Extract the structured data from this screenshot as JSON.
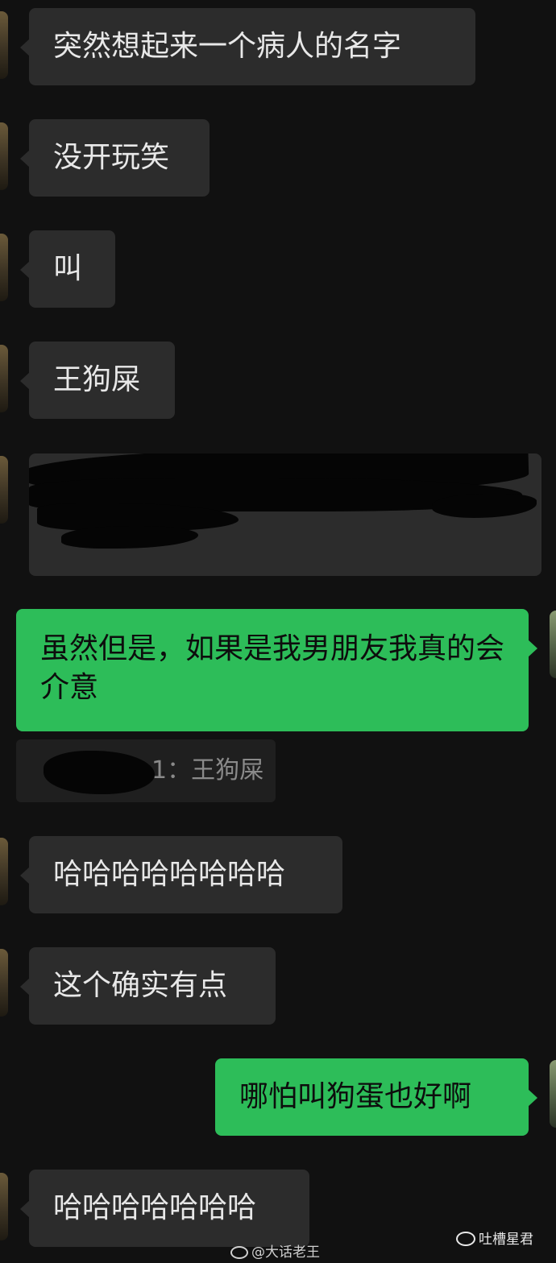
{
  "messages": [
    {
      "text": "突然想起来一个病人的名字"
    },
    {
      "text": "没开玩笑"
    },
    {
      "text": "叫"
    },
    {
      "text": "王狗屎"
    },
    {
      "text": "虽然但是，如果是我男朋友我真的会介意"
    },
    {
      "text": "哈哈哈哈哈哈哈哈"
    },
    {
      "text": "这个确实有点"
    },
    {
      "text": "哪怕叫狗蛋也好啊"
    },
    {
      "text": "哈哈哈哈哈哈哈"
    }
  ],
  "quote": {
    "text": "1：王狗屎"
  },
  "watermark": {
    "text": "@大话老王"
  },
  "brand": {
    "text": "吐槽星君"
  },
  "colors": {
    "background": "#111111",
    "incoming_bubble": "#2c2c2c",
    "outgoing_bubble": "#2dbd59"
  }
}
